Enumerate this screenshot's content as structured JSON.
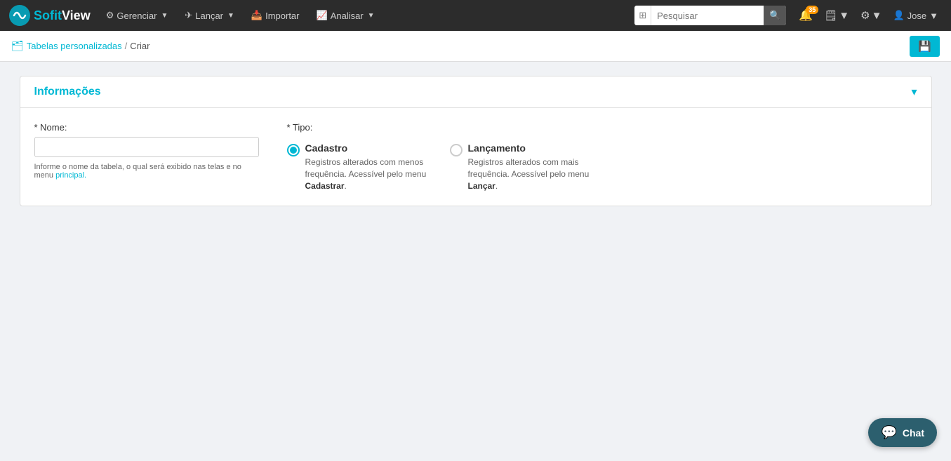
{
  "brand": {
    "soft": "Sofit",
    "view": "View"
  },
  "navbar": {
    "items": [
      {
        "label": "Gerenciar",
        "icon": "⚙",
        "hasDropdown": true
      },
      {
        "label": "Lançar",
        "icon": "✈",
        "hasDropdown": true
      },
      {
        "label": "Importar",
        "icon": "📥",
        "hasDropdown": false
      },
      {
        "label": "Analisar",
        "icon": "📈",
        "hasDropdown": true
      }
    ],
    "search": {
      "placeholder": "Pesquisar"
    },
    "notifications": {
      "count": "35"
    },
    "user": "Jose"
  },
  "breadcrumb": {
    "icon": "🗂",
    "link_label": "Tabelas personalizadas",
    "separator": "/",
    "current": "Criar"
  },
  "save_button_icon": "💾",
  "form": {
    "title": "Informações",
    "name_label": "* Nome:",
    "name_placeholder": "",
    "name_hint": "Informe o nome da tabela, o qual será exibido nas telas e no menu",
    "name_hint_link": "principal.",
    "tipo_label": "* Tipo:",
    "options": [
      {
        "id": "cadastro",
        "title": "Cadastro",
        "description_pre": "Registros alterados com menos frequência. Acessível pelo menu ",
        "description_bold": "Cadastrar",
        "description_post": ".",
        "selected": true
      },
      {
        "id": "lancamento",
        "title": "Lançamento",
        "description_pre": "Registros alterados com mais frequência. Acessível pelo menu ",
        "description_bold": "Lançar",
        "description_post": ".",
        "selected": false
      }
    ]
  },
  "chat": {
    "label": "Chat"
  }
}
